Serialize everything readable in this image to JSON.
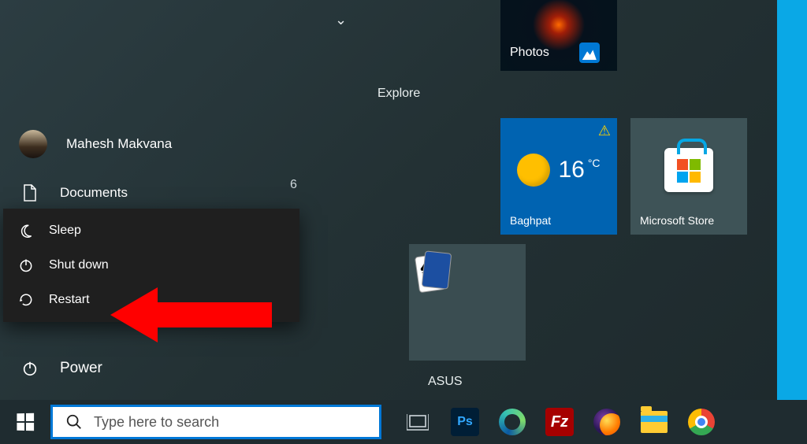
{
  "user": {
    "name": "Mahesh Makvana"
  },
  "left_items": {
    "documents": "Documents",
    "power": "Power",
    "badge": "6"
  },
  "power_menu": {
    "sleep": "Sleep",
    "shutdown": "Shut down",
    "restart": "Restart"
  },
  "sections": {
    "explore": "Explore",
    "asus": "ASUS"
  },
  "tiles": {
    "photos": {
      "label": "Photos"
    },
    "weather": {
      "temp": "16",
      "unit": "°C",
      "location": "Baghpat"
    },
    "store": {
      "label": "Microsoft Store"
    }
  },
  "taskbar": {
    "search_placeholder": "Type here to search"
  }
}
